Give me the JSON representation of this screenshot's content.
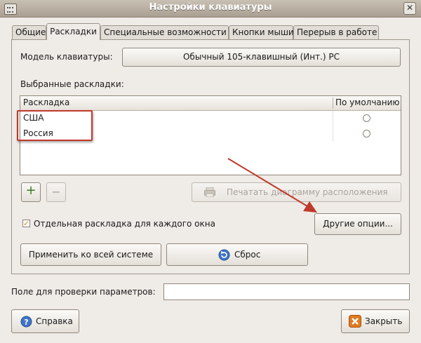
{
  "window": {
    "title": "Настройки клавиатуры"
  },
  "tabs": [
    {
      "label": "Общие"
    },
    {
      "label": "Раскладки"
    },
    {
      "label": "Специальные возможности"
    },
    {
      "label": "Кнопки мыши"
    },
    {
      "label": "Перерыв в работе"
    }
  ],
  "model": {
    "label": "Модель клавиатуры:",
    "value": "Обычный 105-клавишный (Инт.) PC"
  },
  "layouts": {
    "section_label": "Выбранные раскладки:",
    "columns": [
      "Раскладка",
      "По умолчанию"
    ],
    "rows": [
      {
        "name": "США"
      },
      {
        "name": "Россия"
      }
    ]
  },
  "buttons": {
    "add": "+",
    "remove": "−",
    "print": "Печатать диаграмму расположения",
    "other_options": "Другие опции...",
    "apply_system": "Применить ко всей системе",
    "reset": "Сброс",
    "help": "Справка",
    "close": "Закрыть"
  },
  "per_window": {
    "label": "Отдельная раскладка для каждого окна",
    "checked": true
  },
  "test_field": {
    "label": "Поле для проверки параметров:",
    "value": ""
  },
  "annotation_color": "#c0392b"
}
